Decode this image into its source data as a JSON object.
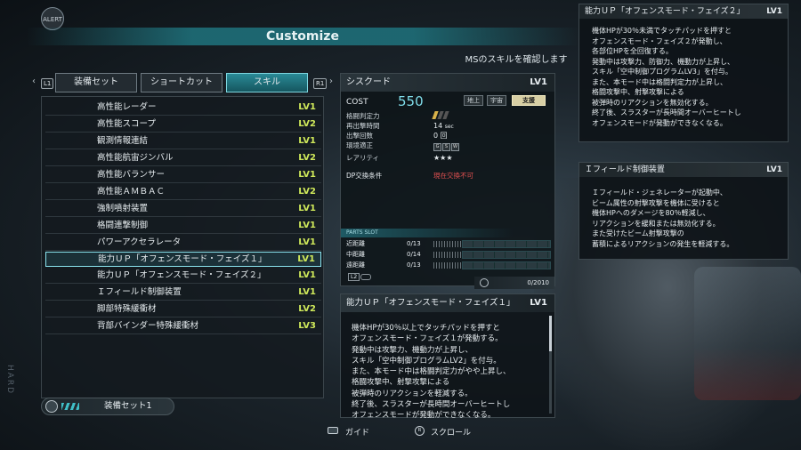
{
  "alert": "ALERT",
  "hard": "HARD",
  "title": "Customize",
  "subtitle": "MSのスキルを確認します",
  "nav": {
    "left_button": "L1",
    "right_button": "R1"
  },
  "tabs": [
    {
      "label": "装備セット",
      "active": false
    },
    {
      "label": "ショートカット",
      "active": false
    },
    {
      "label": "スキル",
      "active": true
    }
  ],
  "skills": [
    {
      "name": "高性能レーダー",
      "lv": "LV1"
    },
    {
      "name": "高性能スコープ",
      "lv": "LV2"
    },
    {
      "name": "観測情報連結",
      "lv": "LV1"
    },
    {
      "name": "高性能航宙ジンバル",
      "lv": "LV2"
    },
    {
      "name": "高性能バランサー",
      "lv": "LV1"
    },
    {
      "name": "高性能ＡＭＢＡＣ",
      "lv": "LV2"
    },
    {
      "name": "強制噴射装置",
      "lv": "LV1"
    },
    {
      "name": "格闘連撃制御",
      "lv": "LV1"
    },
    {
      "name": "パワーアクセラレータ",
      "lv": "LV1"
    },
    {
      "name": "能力ＵＰ「オフェンスモード・フェイズ１」",
      "lv": "LV1",
      "selected": true
    },
    {
      "name": "能力ＵＰ「オフェンスモード・フェイズ２」",
      "lv": "LV1"
    },
    {
      "name": "Ｉフィールド制御装置",
      "lv": "LV1"
    },
    {
      "name": "脚部特殊緩衝材",
      "lv": "LV2"
    },
    {
      "name": "背部バインダー特殊緩衝材",
      "lv": "LV3"
    }
  ],
  "equip_set": "装備セット1",
  "ms": {
    "name": "シスクード",
    "lv": "LV1",
    "cost_label": "COST",
    "cost": "550",
    "terrain": [
      {
        "label": "地上",
        "active": false
      },
      {
        "label": "宇宙",
        "active": false
      },
      {
        "label": "支援",
        "active": true
      }
    ],
    "stats": [
      {
        "key": "格闘判定力",
        "value": ""
      },
      {
        "key": "再出撃時間",
        "value": "14",
        "unit": "sec"
      },
      {
        "key": "出撃回数",
        "value": "0 回"
      },
      {
        "key": "環境適正",
        "value": ""
      },
      {
        "key": "レアリティ",
        "value": "★★★"
      }
    ],
    "env_icons": [
      "G",
      "S",
      "W"
    ],
    "melee_level": 1,
    "dp_label": "DP交換条件",
    "dp_value": "現在交換不可",
    "parts_slot_label": "PARTS SLOT",
    "parts": [
      {
        "label": "近距離",
        "value": "0/13"
      },
      {
        "label": "中距離",
        "value": "0/14"
      },
      {
        "label": "遠距離",
        "value": "0/13"
      }
    ],
    "l2": "L2",
    "dp_total": "0/2010"
  },
  "skill_detail": {
    "title": "能力ＵＰ「オフェンスモード・フェイズ１」",
    "lv": "LV1",
    "lines": [
      "機体HPが30％以上でタッチパッドを押すと",
      "オフェンスモード・フェイズ１が発動する。",
      "発動中は攻撃力、機動力が上昇し、",
      "スキル「空中制御プログラムLV2」を付与。",
      "また、本モード中は格闘判定力がやや上昇し、",
      "格闘攻撃中、射撃攻撃による",
      "被弾時のリアクションを軽減する。",
      "終了後、スラスターが長時間オーバーヒートし",
      "オフェンスモードが発動ができなくなる。"
    ]
  },
  "right_top": {
    "title": "能力ＵＰ「オフェンスモード・フェイズ２」",
    "lv": "LV1",
    "lines": [
      "機体HPが30％未満でタッチパッドを押すと",
      "オフェンスモード・フェイズ２が発動し、",
      "各部位HPを全回復する。",
      "発動中は攻撃力、防御力、機動力が上昇し、",
      "スキル「空中制御プログラムLV3」を付与。",
      "また、本モード中は格闘判定力が上昇し、",
      "格闘攻撃中、射撃攻撃による",
      "被弾時のリアクションを無効化する。",
      "終了後、スラスターが長時間オーバーヒートし",
      "オフェンスモードが発動ができなくなる。"
    ]
  },
  "right_mid": {
    "title": "Ｉフィールド制御装置",
    "lv": "LV1",
    "lines": [
      "Ｉフィールド・ジェネレーターが起動中、",
      "ビーム属性の射撃攻撃を機体に受けると",
      "機体HPへのダメージを80％軽減し、",
      "リアクションを緩和または無効化する。",
      "また受けたビーム射撃攻撃の",
      "蓄積によるリアクションの発生を軽減する。"
    ]
  },
  "footer": {
    "guide": "ガイド",
    "scroll_icon": "R",
    "scroll": "スクロール"
  }
}
